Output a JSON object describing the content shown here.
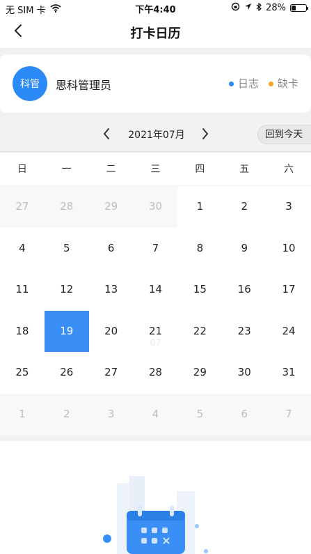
{
  "status": {
    "carrier": "无 SIM 卡",
    "time": "下午4:40",
    "battery": "28%",
    "battery_level": 0.28
  },
  "nav": {
    "title": "打卡日历"
  },
  "user": {
    "avatar_text": "科管",
    "name": "思科管理员"
  },
  "legend": [
    {
      "label": "日志",
      "color": "#2a8af6"
    },
    {
      "label": "缺卡",
      "color": "#f5a623"
    }
  ],
  "month": {
    "label": "2021年07月",
    "today_button": "回到今天"
  },
  "weekdays": [
    "日",
    "一",
    "二",
    "三",
    "四",
    "五",
    "六"
  ],
  "days": [
    {
      "d": "27",
      "other": true
    },
    {
      "d": "28",
      "other": true
    },
    {
      "d": "29",
      "other": true
    },
    {
      "d": "30",
      "other": true
    },
    {
      "d": "1"
    },
    {
      "d": "2"
    },
    {
      "d": "3"
    },
    {
      "d": "4"
    },
    {
      "d": "5"
    },
    {
      "d": "6"
    },
    {
      "d": "7"
    },
    {
      "d": "8"
    },
    {
      "d": "9"
    },
    {
      "d": "10"
    },
    {
      "d": "11"
    },
    {
      "d": "12"
    },
    {
      "d": "13"
    },
    {
      "d": "14"
    },
    {
      "d": "15"
    },
    {
      "d": "16"
    },
    {
      "d": "17"
    },
    {
      "d": "18"
    },
    {
      "d": "19",
      "selected": true
    },
    {
      "d": "20"
    },
    {
      "d": "21",
      "sub": "07"
    },
    {
      "d": "22"
    },
    {
      "d": "23"
    },
    {
      "d": "24"
    },
    {
      "d": "25"
    },
    {
      "d": "26"
    },
    {
      "d": "27"
    },
    {
      "d": "28"
    },
    {
      "d": "29"
    },
    {
      "d": "30"
    },
    {
      "d": "31"
    },
    {
      "d": "1",
      "other": true
    },
    {
      "d": "2",
      "other": true
    },
    {
      "d": "3",
      "other": true
    },
    {
      "d": "4",
      "other": true
    },
    {
      "d": "5",
      "other": true
    },
    {
      "d": "6",
      "other": true
    },
    {
      "d": "7",
      "other": true
    }
  ],
  "icons": {
    "back": "chevron-left-icon",
    "prev": "chevron-left-icon",
    "next": "chevron-right-icon",
    "wifi": "wifi-icon",
    "location": "location-arrow-icon",
    "bluetooth": "bluetooth-icon",
    "lock": "orientation-lock-icon",
    "battery": "battery-icon",
    "empty": "calendar-empty-illustration"
  }
}
